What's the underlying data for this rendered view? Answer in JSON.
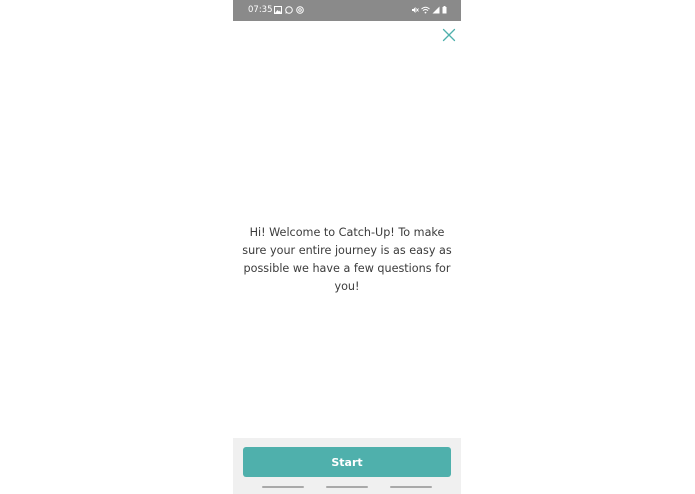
{
  "status_bar": {
    "time": "07:35",
    "left_icons": [
      "image-icon",
      "whatsapp-icon",
      "at-icon"
    ],
    "right_icons": [
      "mute-icon",
      "wifi-icon",
      "signal-icon",
      "battery-icon"
    ]
  },
  "header": {
    "close_icon": "close-icon"
  },
  "main": {
    "welcome_message": "Hi! Welcome to Catch-Up! To make sure your entire journey is as easy as possible we have a few questions for you!"
  },
  "footer": {
    "start_label": "Start"
  },
  "colors": {
    "accent": "#4fb0ac",
    "status_bar": "#8a8a8a",
    "text": "#3b3b3b",
    "footer_bg": "#f0f0f0"
  }
}
